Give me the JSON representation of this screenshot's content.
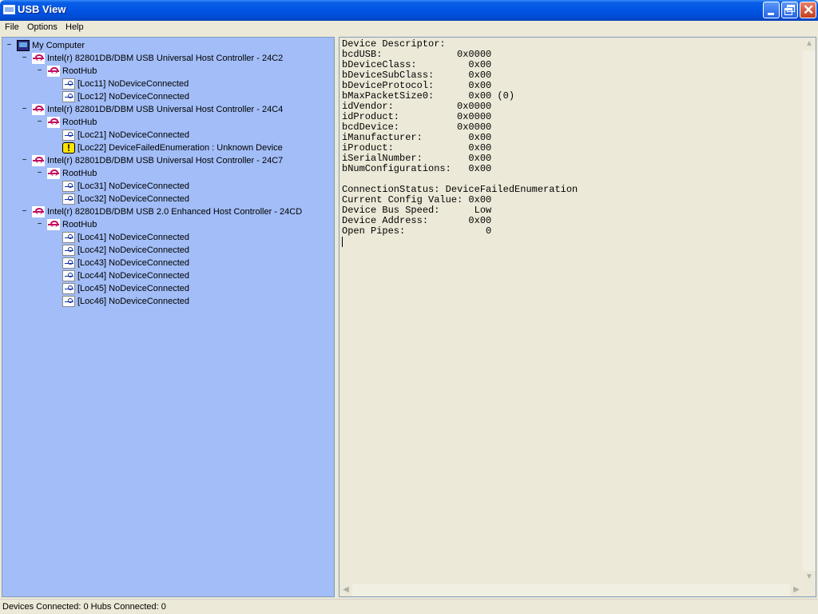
{
  "window": {
    "title": "USB View"
  },
  "menu": {
    "items": [
      "File",
      "Options",
      "Help"
    ]
  },
  "tree": {
    "nodes": [
      {
        "label": "My Computer",
        "icon": "computer-icon",
        "level": 0,
        "expander": "−"
      },
      {
        "label": "Intel(r) 82801DB/DBM USB Universal Host Controller - 24C2",
        "icon": "host-controller-icon",
        "level": 1,
        "expander": "−"
      },
      {
        "label": "RootHub",
        "icon": "hub-icon",
        "level": 2,
        "expander": "−"
      },
      {
        "label": "[Loc11] NoDeviceConnected",
        "icon": "usb-port-icon",
        "level": 3
      },
      {
        "label": "[Loc12] NoDeviceConnected",
        "icon": "usb-port-icon",
        "level": 3
      },
      {
        "label": "Intel(r) 82801DB/DBM USB Universal Host Controller - 24C4",
        "icon": "host-controller-icon",
        "level": 1,
        "expander": "−"
      },
      {
        "label": "RootHub",
        "icon": "hub-icon",
        "level": 2,
        "expander": "−"
      },
      {
        "label": "[Loc21] NoDeviceConnected",
        "icon": "usb-port-icon",
        "level": 3
      },
      {
        "label": "[Loc22] DeviceFailedEnumeration :  Unknown Device",
        "icon": "warning-icon",
        "level": 3
      },
      {
        "label": "Intel(r) 82801DB/DBM USB Universal Host Controller - 24C7",
        "icon": "host-controller-icon",
        "level": 1,
        "expander": "−"
      },
      {
        "label": "RootHub",
        "icon": "hub-icon",
        "level": 2,
        "expander": "−"
      },
      {
        "label": "[Loc31] NoDeviceConnected",
        "icon": "usb-port-icon",
        "level": 3
      },
      {
        "label": "[Loc32] NoDeviceConnected",
        "icon": "usb-port-icon",
        "level": 3
      },
      {
        "label": "Intel(r) 82801DB/DBM USB 2.0 Enhanced Host Controller - 24CD",
        "icon": "host-controller-icon",
        "level": 1,
        "expander": "−"
      },
      {
        "label": "RootHub",
        "icon": "hub-icon",
        "level": 2,
        "expander": "−"
      },
      {
        "label": "[Loc41] NoDeviceConnected",
        "icon": "usb-port-icon",
        "level": 3
      },
      {
        "label": "[Loc42] NoDeviceConnected",
        "icon": "usb-port-icon",
        "level": 3
      },
      {
        "label": "[Loc43] NoDeviceConnected",
        "icon": "usb-port-icon",
        "level": 3
      },
      {
        "label": "[Loc44] NoDeviceConnected",
        "icon": "usb-port-icon",
        "level": 3
      },
      {
        "label": "[Loc45] NoDeviceConnected",
        "icon": "usb-port-icon",
        "level": 3
      },
      {
        "label": "[Loc46] NoDeviceConnected",
        "icon": "usb-port-icon",
        "level": 3
      }
    ]
  },
  "details": {
    "text": "Device Descriptor:\nbcdUSB:             0x0000\nbDeviceClass:         0x00\nbDeviceSubClass:      0x00\nbDeviceProtocol:      0x00\nbMaxPacketSize0:      0x00 (0)\nidVendor:           0x0000\nidProduct:          0x0000\nbcdDevice:          0x0000\niManufacturer:        0x00\niProduct:             0x00\niSerialNumber:        0x00\nbNumConfigurations:   0x00\n\nConnectionStatus: DeviceFailedEnumeration\nCurrent Config Value: 0x00\nDevice Bus Speed:      Low\nDevice Address:       0x00\nOpen Pipes:              0"
  },
  "status": {
    "text": "Devices Connected: 0   Hubs Connected: 0"
  }
}
